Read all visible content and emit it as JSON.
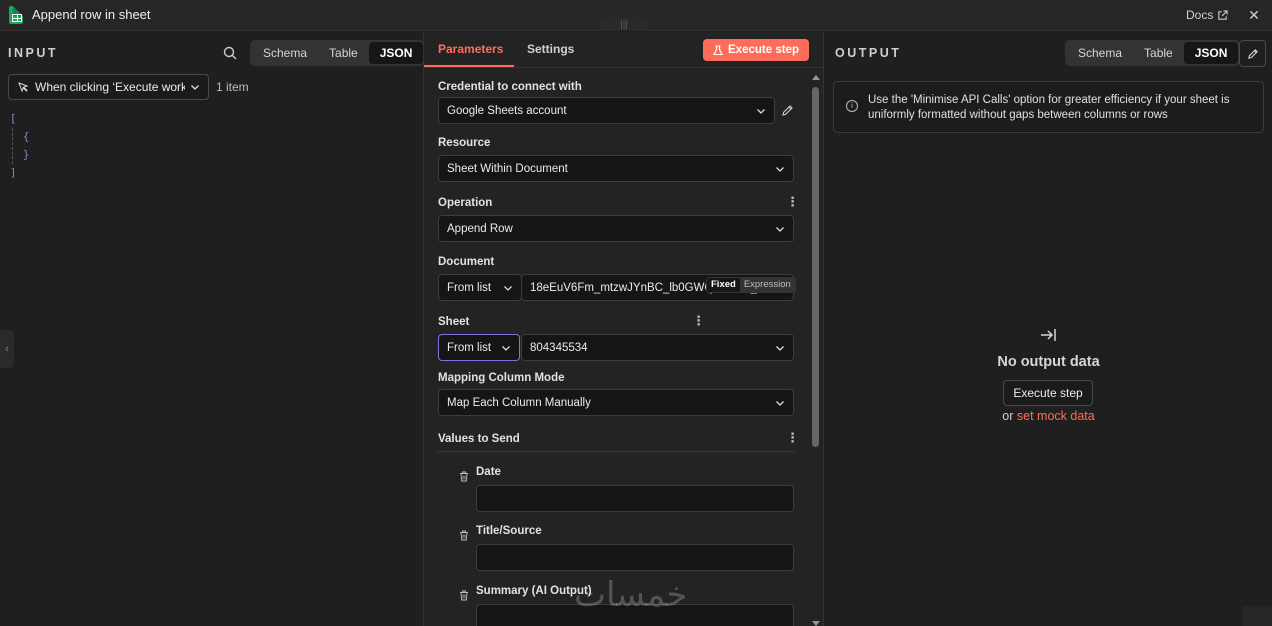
{
  "window": {
    "title": "Append row in sheet",
    "docs_label": "Docs",
    "close_glyph": "✕",
    "drag_glyph": "|||"
  },
  "input": {
    "label": "INPUT",
    "view_tabs": [
      "Schema",
      "Table",
      "JSON"
    ],
    "active_tab": "JSON",
    "trigger_node": "When clicking ‘Execute workflow’",
    "item_count": "1 item",
    "json_lines": [
      "[",
      "{",
      "}",
      "]"
    ]
  },
  "params": {
    "tabs": {
      "parameters": "Parameters",
      "settings": "Settings"
    },
    "execute_label": "Execute step",
    "credential": {
      "label": "Credential to connect with",
      "value": "Google Sheets account"
    },
    "resource": {
      "label": "Resource",
      "value": "Sheet Within Document"
    },
    "operation": {
      "label": "Operation",
      "value": "Append Row"
    },
    "document": {
      "label": "Document",
      "mode": "From list",
      "value": "18eEuV6Fm_mtzwJYnBC_lb0GWQE9wew_IC..."
    },
    "sheet": {
      "label": "Sheet",
      "mode": "From list",
      "value": "804345534",
      "toggle_fixed": "Fixed",
      "toggle_expression": "Expression"
    },
    "mapping": {
      "label": "Mapping Column Mode",
      "value": "Map Each Column Manually"
    },
    "values": {
      "label": "Values to Send",
      "fields": [
        {
          "label": "Date",
          "value": ""
        },
        {
          "label": "Title/Source",
          "value": ""
        },
        {
          "label": "Summary (AI Output)",
          "value": ""
        }
      ]
    }
  },
  "output": {
    "label": "OUTPUT",
    "view_tabs": [
      "Schema",
      "Table",
      "JSON"
    ],
    "active_tab": "JSON",
    "info_text": "Use the 'Minimise API Calls' option for greater efficiency if your sheet is uniformly formatted without gaps between columns or rows",
    "empty_title": "No output data",
    "execute_label": "Execute step",
    "or_text": "or",
    "mock_link": "set mock data"
  },
  "watermark": "خمسات",
  "colors": {
    "accent": "#ff6d5a",
    "json": "#8f86d8",
    "sheets_green": "#1fa463"
  }
}
